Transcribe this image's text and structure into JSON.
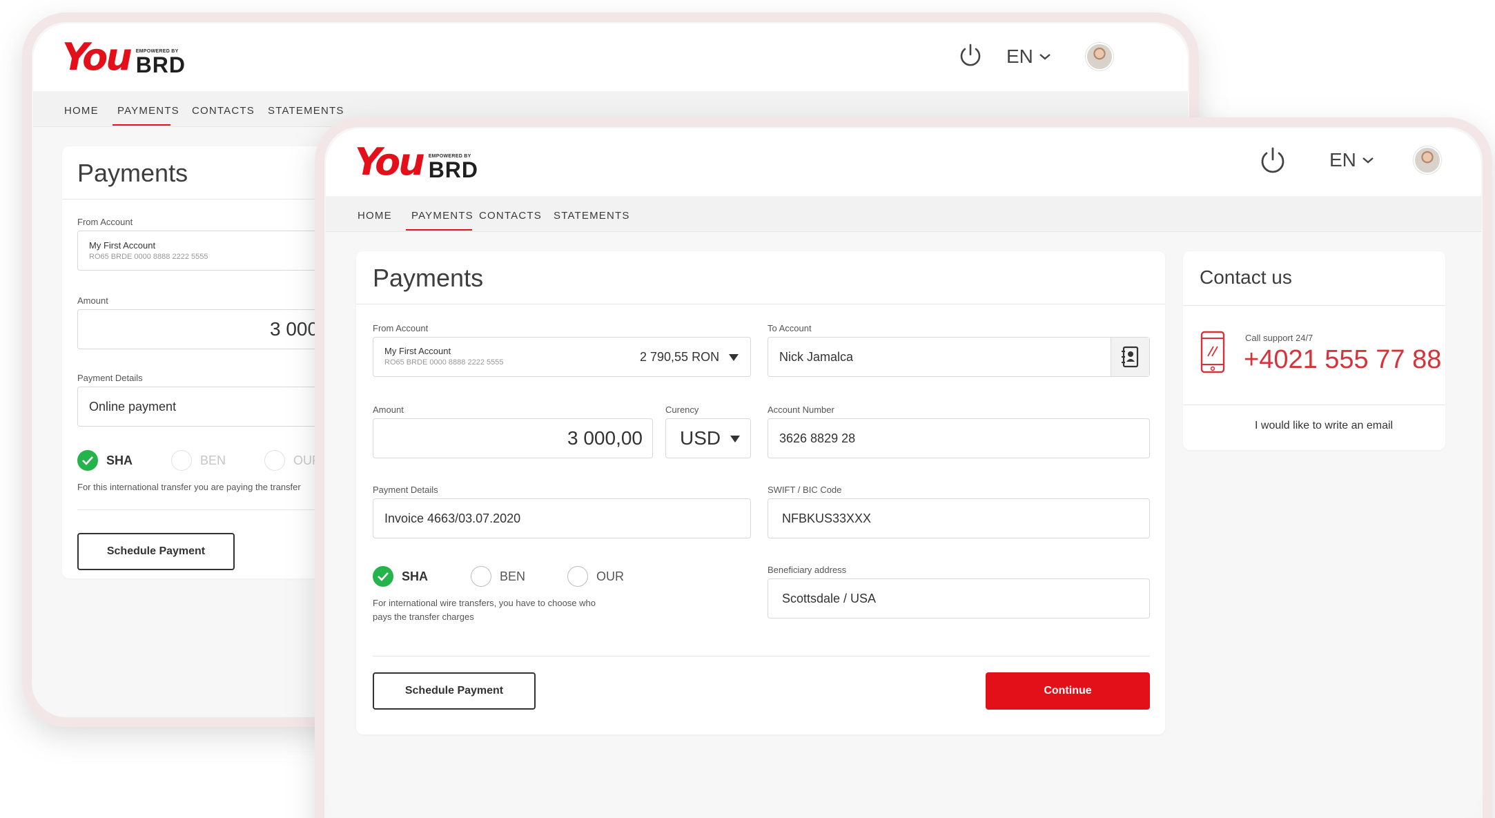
{
  "brand": {
    "you": "You",
    "tagline": "EMPOWERED BY",
    "bank": "BRD"
  },
  "header": {
    "language": "EN"
  },
  "nav": {
    "items": [
      "HOME",
      "PAYMENTS",
      "CONTACTS",
      "STATEMENTS"
    ],
    "active": "PAYMENTS"
  },
  "back": {
    "title": "Payments",
    "from_label": "From Account",
    "from_name": "My First Account",
    "from_iban": "RO65 BRDE 0000 8888 2222 5555",
    "amount_label": "Amount",
    "amount_value": "3 000,",
    "details_label": "Payment Details",
    "details_value": "Online payment",
    "charges": [
      "SHA",
      "BEN",
      "OUR"
    ],
    "note": "For this international transfer you are paying the transfer",
    "schedule_label": "Schedule Payment"
  },
  "front": {
    "title": "Payments",
    "from_label": "From Account",
    "from_name": "My First Account",
    "from_iban": "RO65 BRDE 0000 8888 2222 5555",
    "from_balance": "2 790,55 RON",
    "to_label": "To Account",
    "to_value": "Nick Jamalca",
    "amount_label": "Amount",
    "amount_value": "3 000,00",
    "currency_label": "Curency",
    "currency_value": "USD",
    "account_number_label": "Account Number",
    "account_number_value": "3626 8829 28",
    "details_label": "Payment Details",
    "details_value": "Invoice 4663/03.07.2020",
    "swift_label": "SWIFT / BIC Code",
    "swift_value": "NFBKUS33XXX",
    "charges": [
      "SHA",
      "BEN",
      "OUR"
    ],
    "selected_charge": "SHA",
    "beneficiary_label": "Beneficiary address",
    "beneficiary_value": "Scottsdale / USA",
    "note_line1": "For international wire transfers, you have to choose who",
    "note_line2": "pays the transfer charges",
    "schedule_label": "Schedule Payment",
    "continue_label": "Continue"
  },
  "contact": {
    "title": "Contact us",
    "support_label": "Call support 24/7",
    "phone": "+4021 555 77 88",
    "email_link": "I would like to write an email"
  },
  "colors": {
    "brand_red": "#e3101a",
    "phone_red": "#d7323a",
    "check_green": "#25b34b"
  }
}
